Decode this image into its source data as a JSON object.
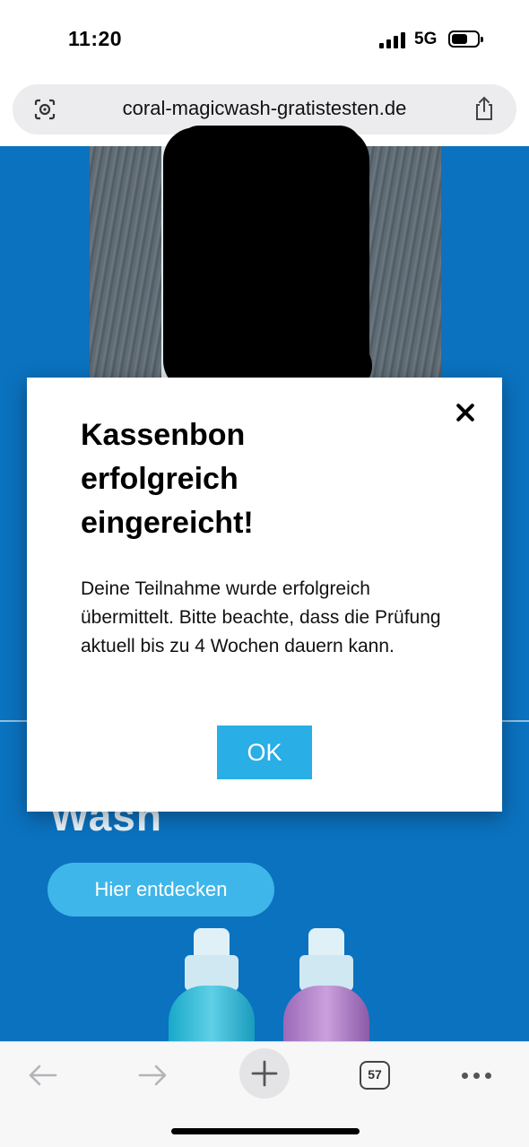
{
  "status_bar": {
    "time": "11:20",
    "network": "5G",
    "signal_icon": "cellular-signal-icon",
    "battery_icon": "battery-icon"
  },
  "browser": {
    "url": "coral-magicwash-gratistesten.de",
    "left_icon": "page-settings-icon",
    "share_icon": "share-icon"
  },
  "page": {
    "hero_title_fragment": "Wash",
    "cta_label": "Hier entdecken",
    "background_color": "#0b72bf"
  },
  "modal": {
    "title": "Kassenbon erfolgreich eingereicht!",
    "body": "Deine Teilnahme wurde erfolgreich übermittelt. Bitte beachte, dass die Prüfung aktuell bis zu 4 Wochen dauern kann.",
    "ok_label": "OK",
    "close_icon": "close-icon",
    "accent_color": "#29aee6"
  },
  "toolbar": {
    "back_icon": "arrow-left-icon",
    "forward_icon": "arrow-right-icon",
    "new_tab_icon": "plus-icon",
    "tab_count": "57",
    "more_icon": "more-dots-icon"
  }
}
